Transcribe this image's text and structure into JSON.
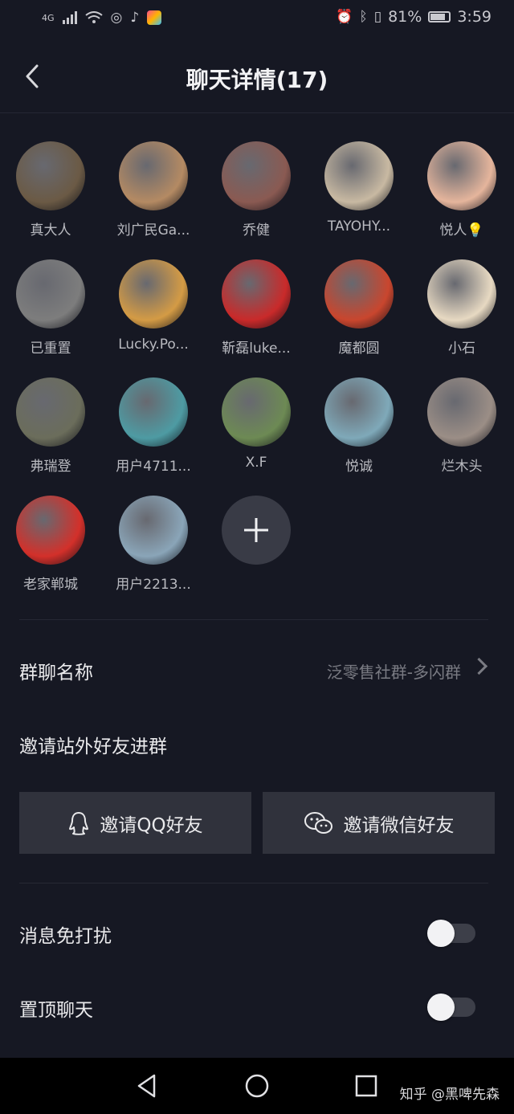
{
  "status_bar": {
    "signal": "4G",
    "battery": "81%",
    "battery_level": 0.81,
    "time": "3:59"
  },
  "header": {
    "title": "聊天详情(17)",
    "back_icon": "chevron-left-icon"
  },
  "members": [
    {
      "name": "真大人",
      "avatar_color": "#6b5a45"
    },
    {
      "name": "刘广民Ga...",
      "avatar_color": "#b48a63"
    },
    {
      "name": "乔健",
      "avatar_color": "#8a5a52"
    },
    {
      "name": "TAYOHY...",
      "avatar_color": "#c8b9a2"
    },
    {
      "name": "悦人💡",
      "avatar_color": "#e5b59c"
    },
    {
      "name": "已重置",
      "avatar_color": "#7d7d7d"
    },
    {
      "name": "Lucky.Po...",
      "avatar_color": "#d49b45"
    },
    {
      "name": "靳磊luke...",
      "avatar_color": "#c92a2a"
    },
    {
      "name": "魔都圆",
      "avatar_color": "#c9462e"
    },
    {
      "name": "小石",
      "avatar_color": "#e7d9c2"
    },
    {
      "name": "弗瑞登",
      "avatar_color": "#6b6d5b"
    },
    {
      "name": "用户4711...",
      "avatar_color": "#4e9ba3"
    },
    {
      "name": "X.F",
      "avatar_color": "#6d8a54"
    },
    {
      "name": "悦诚",
      "avatar_color": "#7fa9b9"
    },
    {
      "name": "烂木头",
      "avatar_color": "#9b8e86"
    },
    {
      "name": "老家郸城",
      "avatar_color": "#d3302a"
    },
    {
      "name": "用户2213...",
      "avatar_color": "#8aa5b8"
    }
  ],
  "group_name": {
    "label": "群聊名称",
    "value": "泛零售社群-多闪群"
  },
  "invite": {
    "section_label": "邀请站外好友进群",
    "qq_button": "邀请QQ好友",
    "wechat_button": "邀请微信好友"
  },
  "settings": {
    "mute_label": "消息免打扰",
    "mute_on": false,
    "pin_label": "置顶聊天",
    "pin_on": false
  },
  "watermark": "知乎 @黑啤先森",
  "colors": {
    "background": "#161823",
    "button": "#30323c",
    "muted_text": "#7a7b83"
  }
}
